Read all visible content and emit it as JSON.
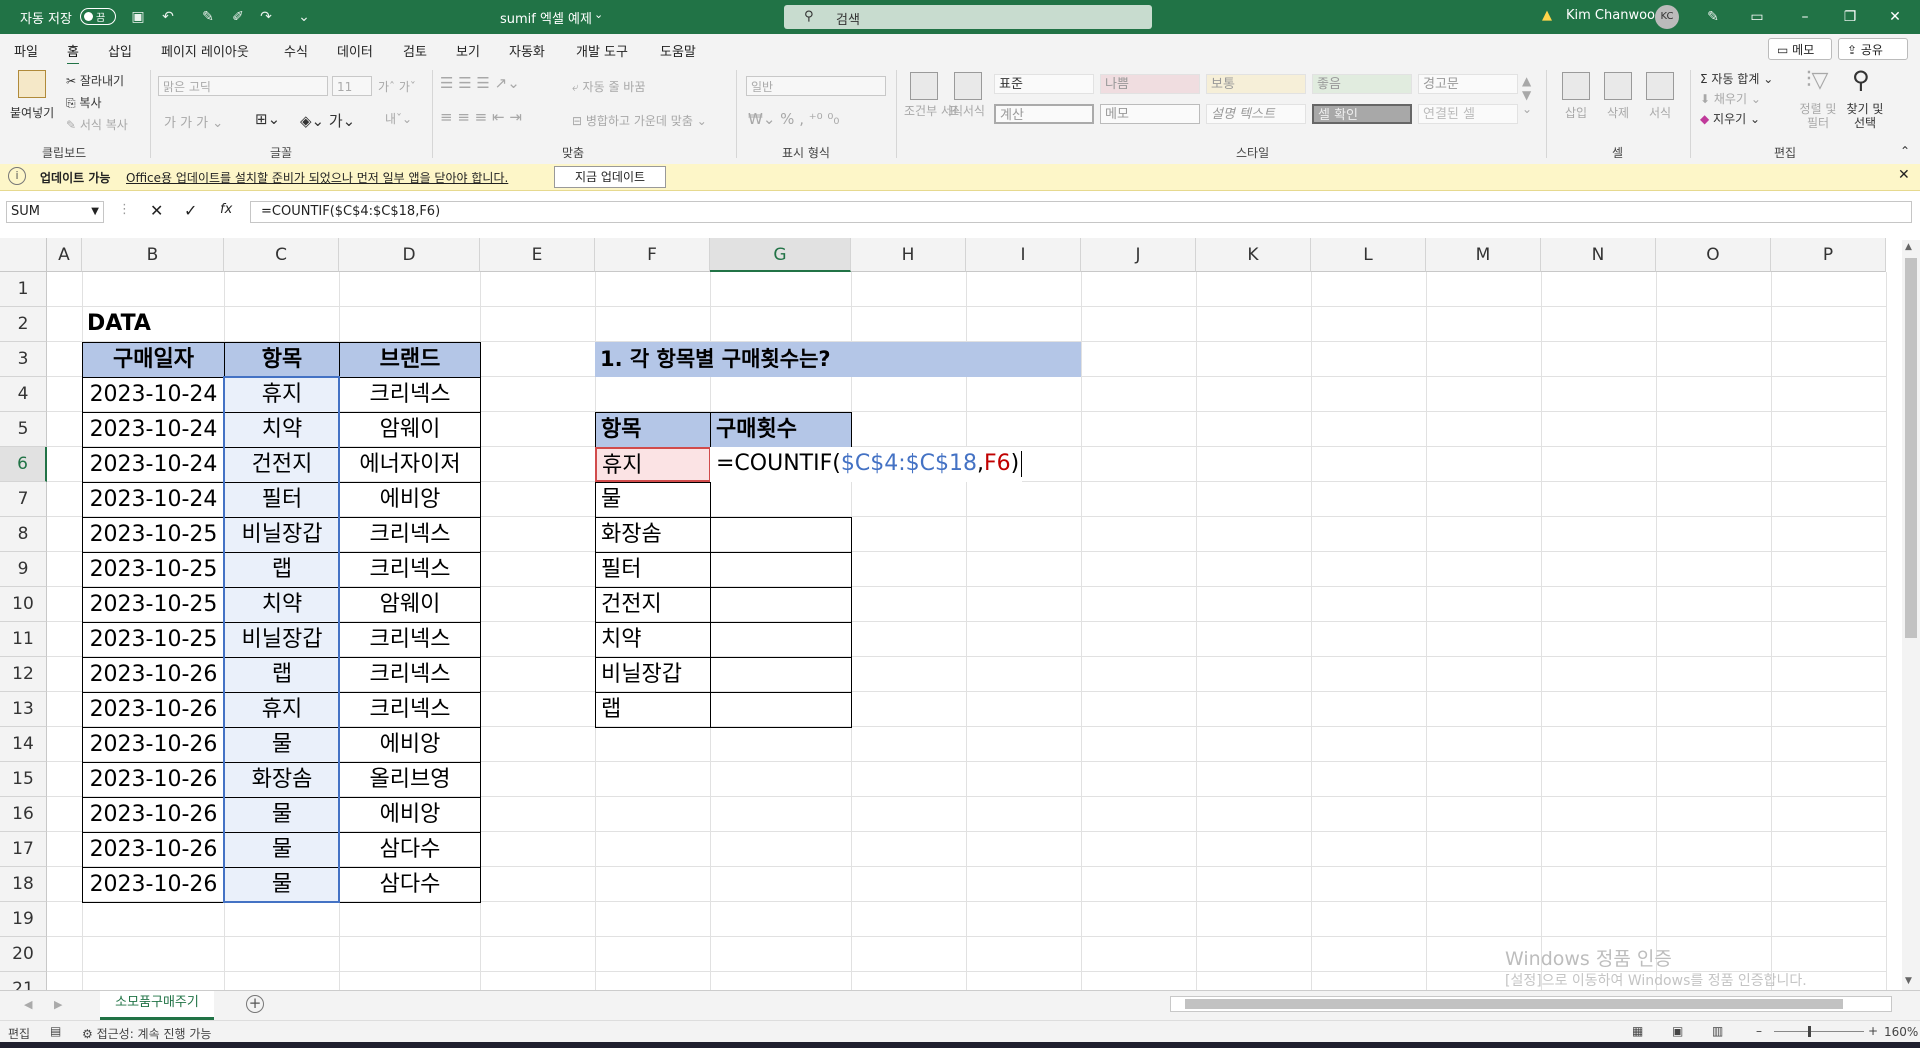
{
  "titlebar": {
    "autosave_label": "자동 저장",
    "autosave_state": "끔",
    "doc_title": "sumif 엑셀 예제",
    "search_placeholder": "검색",
    "user_name": "Kim Chanwoo",
    "user_initials": "KC"
  },
  "menu": {
    "tabs": [
      "파일",
      "홈",
      "삽입",
      "페이지 레이아웃",
      "수식",
      "데이터",
      "검토",
      "보기",
      "자동화",
      "개발 도구",
      "도움말"
    ],
    "memo": "메모",
    "share": "공유"
  },
  "ribbon": {
    "clipboard": {
      "paste": "붙여넣기",
      "cut": "잘라내기",
      "copy": "복사",
      "format_painter": "서식 복사",
      "label": "클립보드"
    },
    "font": {
      "name": "맑은 고딕",
      "size": "11",
      "label": "글꼴"
    },
    "align": {
      "wrap": "자동 줄 바꿈",
      "merge": "병합하고 가운데 맞춤",
      "label": "맞춤"
    },
    "number": {
      "format": "일반",
      "label": "표시 형식"
    },
    "styles": {
      "cond_format": "조건부 서식",
      "table_format": "표 서식",
      "cells": [
        "표준",
        "나쁨",
        "보통",
        "좋음",
        "경고문",
        "계산",
        "메모",
        "설명 텍스트",
        "셀 확인",
        "연결된 셀"
      ],
      "label": "스타일"
    },
    "cells": {
      "insert": "삽입",
      "delete": "삭제",
      "format": "서식",
      "label": "셀"
    },
    "editing": {
      "autosum": "자동 합계",
      "fill": "채우기",
      "clear": "지우기",
      "sort": "정렬 및 필터",
      "find": "찾기 및 선택",
      "label": "편집"
    }
  },
  "update_bar": {
    "title": "업데이트 가능",
    "message": "Office용 업데이트를 설치할 준비가 되었으나 먼저 일부 앱을 닫아야 합니다.",
    "button": "지금 업데이트"
  },
  "formula_bar": {
    "name_box": "SUM",
    "formula": "=COUNTIF($C$4:$C$18,F6)"
  },
  "sheet": {
    "columns": [
      "A",
      "B",
      "C",
      "D",
      "E",
      "F",
      "G",
      "H",
      "I",
      "J",
      "K",
      "L",
      "M",
      "N",
      "O",
      "P"
    ],
    "rows": [
      "1",
      "2",
      "3",
      "4",
      "5",
      "6",
      "7",
      "8",
      "9",
      "10",
      "11",
      "12",
      "13",
      "14",
      "15",
      "16",
      "17",
      "18",
      "19",
      "20",
      "21"
    ],
    "data_title": "DATA",
    "headers": [
      "구매일자",
      "항목",
      "브랜드"
    ],
    "data": [
      [
        "2023-10-24",
        "휴지",
        "크리넥스"
      ],
      [
        "2023-10-24",
        "치약",
        "암웨이"
      ],
      [
        "2023-10-24",
        "건전지",
        "에너자이저"
      ],
      [
        "2023-10-24",
        "필터",
        "에비앙"
      ],
      [
        "2023-10-25",
        "비닐장갑",
        "크리넥스"
      ],
      [
        "2023-10-25",
        "랩",
        "크리넥스"
      ],
      [
        "2023-10-25",
        "치약",
        "암웨이"
      ],
      [
        "2023-10-25",
        "비닐장갑",
        "크리넥스"
      ],
      [
        "2023-10-26",
        "랩",
        "크리넥스"
      ],
      [
        "2023-10-26",
        "휴지",
        "크리넥스"
      ],
      [
        "2023-10-26",
        "물",
        "에비앙"
      ],
      [
        "2023-10-26",
        "화장솜",
        "올리브영"
      ],
      [
        "2023-10-26",
        "물",
        "에비앙"
      ],
      [
        "2023-10-26",
        "물",
        "삼다수"
      ],
      [
        "2023-10-26",
        "물",
        "삼다수"
      ]
    ],
    "question": "1. 각 항목별 구매횟수는?",
    "summary_headers": [
      "항목",
      "구매횟수"
    ],
    "summary_items": [
      "휴지",
      "물",
      "화장솜",
      "필터",
      "건전지",
      "치약",
      "비닐장갑",
      "랩"
    ],
    "editing_formula": {
      "prefix": "=COUNTIF(",
      "range": "$C$4:$C$18",
      "comma": ",",
      "ref": "F6",
      "suffix": ")"
    }
  },
  "watermark": {
    "line1": "Windows 정품 인증",
    "line2": "[설정]으로 이동하여 Windows를 정품 인증합니다."
  },
  "tabs": {
    "sheet_tab": "소모품구매주기"
  },
  "status": {
    "mode": "편집",
    "accessibility": "접근성: 계속 진행 가능",
    "zoom": "160%"
  },
  "colors": {
    "excel_green": "#217346",
    "header_blue": "#b4c6e7",
    "range_blue": "#4472c4",
    "ref_red": "#c00000"
  }
}
